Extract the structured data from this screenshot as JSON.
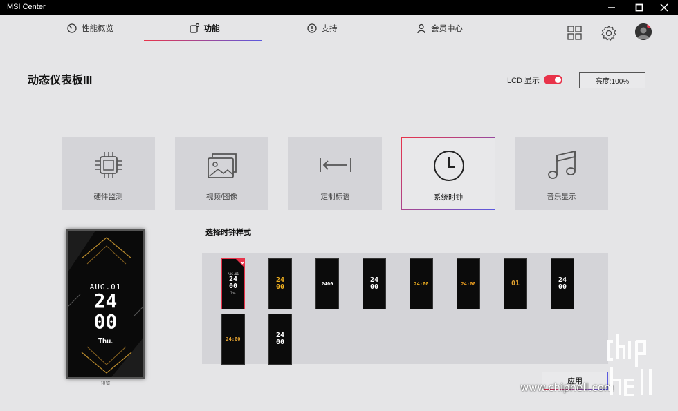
{
  "window": {
    "title": "MSI Center",
    "minimize": "—",
    "maximize": "□",
    "close": "✕"
  },
  "nav": {
    "tabs": [
      {
        "label": "性能概览",
        "icon": "gauge-icon"
      },
      {
        "label": "功能",
        "icon": "feature-icon",
        "active": true
      },
      {
        "label": "支持",
        "icon": "support-icon"
      },
      {
        "label": "会员中心",
        "icon": "user-icon"
      }
    ],
    "right_icons": [
      "grid-icon",
      "gear-icon",
      "avatar"
    ]
  },
  "page": {
    "title": "动态仪表板III",
    "lcd_label": "LCD 显示",
    "lcd_on": true,
    "brightness_label": "亮度:100%"
  },
  "tiles": [
    {
      "label": "硬件监测",
      "icon": "chip-icon"
    },
    {
      "label": "视频/图像",
      "icon": "image-icon"
    },
    {
      "label": "定制标语",
      "icon": "banner-icon"
    },
    {
      "label": "系统时钟",
      "icon": "clock-icon",
      "selected": true
    },
    {
      "label": "音乐显示",
      "icon": "music-icon"
    }
  ],
  "preview": {
    "date": "AUG.01",
    "hour": "24",
    "minute": "00",
    "day": "Thu.",
    "caption": "预览"
  },
  "styles": {
    "title": "选择时钟样式",
    "selected_index": 0,
    "items": [
      {
        "date": "AUG.01",
        "time": "24\n00",
        "day": "Thu.",
        "color": "#ffffff"
      },
      {
        "date": "",
        "time": "24\n00",
        "day": "",
        "color": "#f0b020"
      },
      {
        "date": "",
        "time": "2400",
        "day": "",
        "color": "#ffffff"
      },
      {
        "date": "",
        "time": "24\n00",
        "day": "",
        "color": "#ffffff"
      },
      {
        "date": "",
        "time": "24:00",
        "day": "",
        "color": "#f0b020"
      },
      {
        "date": "",
        "time": "24:00",
        "day": "",
        "color": "#f0a020"
      },
      {
        "date": "",
        "time": "01",
        "day": "",
        "color": "#e0a030"
      },
      {
        "date": "",
        "time": "24\n00",
        "day": "",
        "color": "#ffffff"
      },
      {
        "date": "",
        "time": "24:00",
        "day": "",
        "color": "#e0a030"
      },
      {
        "date": "",
        "time": "24\n00",
        "day": "",
        "color": "#ffffff"
      }
    ]
  },
  "apply_label": "应用",
  "watermark": {
    "text": "www.chiphell.com"
  },
  "colors": {
    "accent_red": "#e8334a",
    "accent_blue": "#5a5ae0",
    "bg": "#e5e5e7",
    "tile_bg": "#d4d4d8"
  }
}
